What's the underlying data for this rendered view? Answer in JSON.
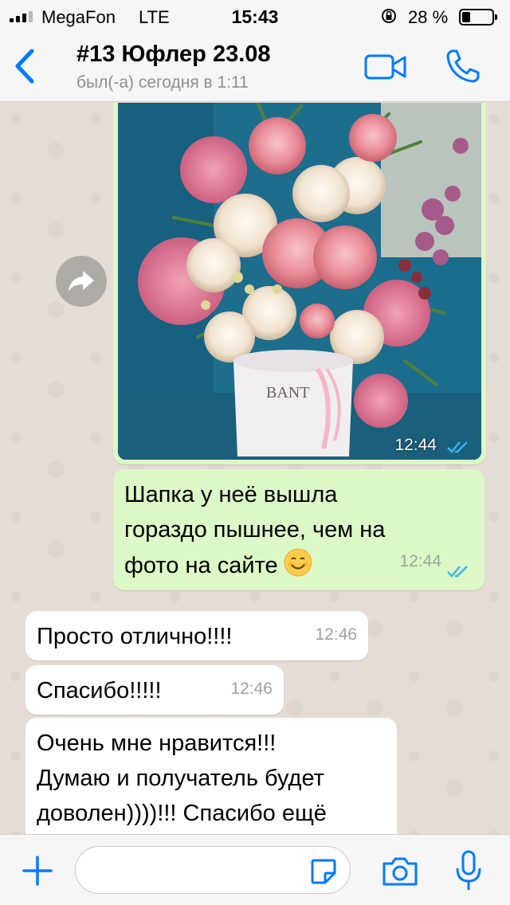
{
  "status_bar": {
    "carrier": "MegaFon",
    "network": "LTE",
    "time": "15:43",
    "battery_percent_label": "28 %",
    "battery_level": 0.28
  },
  "header": {
    "back_icon": "chevron-left-icon",
    "title": "#13 Юфлер 23.08",
    "subtitle": "был(-а) сегодня в 1:11",
    "video_icon": "video-camera-icon",
    "call_icon": "phone-icon",
    "accent_color": "#007aff"
  },
  "messages": [
    {
      "type": "photo",
      "direction": "outgoing",
      "image_text": "BANT",
      "time": "12:44",
      "status": "read",
      "forward_icon": "forward-arrow-icon"
    },
    {
      "type": "text",
      "direction": "outgoing",
      "lines": [
        "Шапка у неё вышла",
        "гораздо пышнее, чем на",
        "фото на сайте"
      ],
      "emoji": "smiling-face-emoji",
      "time": "12:44",
      "status": "read"
    },
    {
      "type": "text",
      "direction": "incoming",
      "lines": [
        "Просто отлично!!!!"
      ],
      "time": "12:46"
    },
    {
      "type": "text",
      "direction": "incoming",
      "lines": [
        "Спасибо!!!!!"
      ],
      "time": "12:46"
    },
    {
      "type": "text",
      "direction": "incoming",
      "lines": [
        "Очень мне нравится!!!",
        "Думаю и получатель будет",
        "доволен))))!!! Спасибо ещё"
      ]
    }
  ],
  "colors": {
    "outgoing_bubble": "#dcf8c6",
    "incoming_bubble": "#ffffff",
    "chat_background": "#e5ddd5",
    "read_ticks": "#34b7f1"
  },
  "input_bar": {
    "placeholder": "",
    "plus_icon": "plus-icon",
    "sticker_icon": "sticker-icon",
    "camera_icon": "camera-icon",
    "mic_icon": "microphone-icon"
  }
}
